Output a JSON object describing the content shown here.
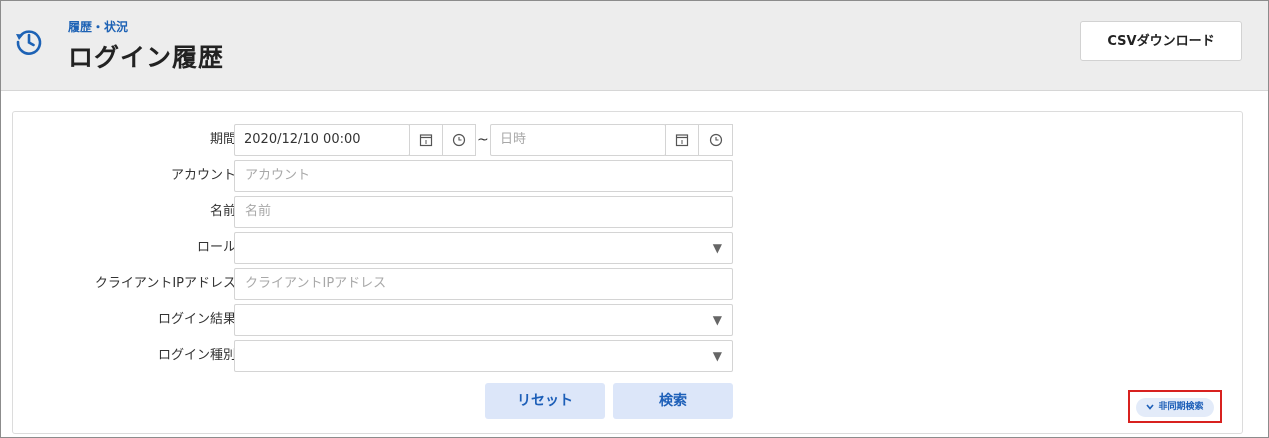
{
  "header": {
    "breadcrumb": "履歴・状況",
    "title": "ログイン履歴",
    "csv_button": "CSVダウンロード"
  },
  "form": {
    "period": {
      "label": "期間",
      "start_value": "2020/12/10 00:00",
      "separator": "~",
      "end_placeholder": "日時"
    },
    "account": {
      "label": "アカウント",
      "placeholder": "アカウント"
    },
    "name": {
      "label": "名前",
      "placeholder": "名前"
    },
    "role": {
      "label": "ロール",
      "value": ""
    },
    "client_ip": {
      "label": "クライアントIPアドレス",
      "placeholder": "クライアントIPアドレス"
    },
    "login_result": {
      "label": "ログイン結果",
      "value": ""
    },
    "login_type": {
      "label": "ログイン種別",
      "value": ""
    },
    "reset_button": "リセット",
    "search_button": "検索",
    "async_search_button": "非同期検索"
  },
  "colors": {
    "accent": "#1d62b5",
    "button_bg": "#dce6f9",
    "highlight_border": "#d8211f"
  }
}
